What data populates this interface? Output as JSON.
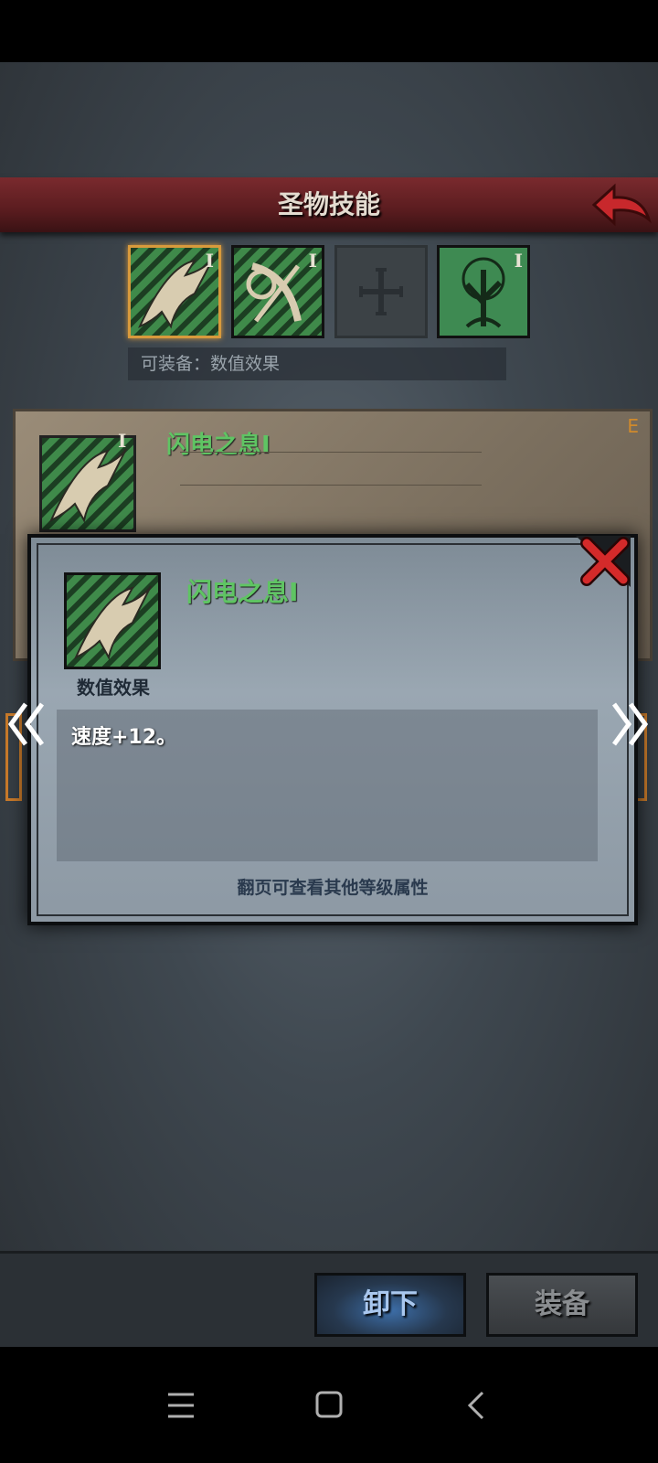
{
  "header": {
    "title": "圣物技能"
  },
  "skill_slots": [
    {
      "level": "I",
      "icon": "lightning-breath-icon",
      "selected": true
    },
    {
      "level": "I",
      "icon": "bow-sword-icon",
      "selected": false
    },
    {
      "level": "",
      "icon": "empty-cross-slot-icon",
      "selected": false
    },
    {
      "level": "I",
      "icon": "tree-icon",
      "selected": false
    }
  ],
  "equip_hint": "可装备：数值效果",
  "background_card": {
    "name": "闪电之息I",
    "level": "I",
    "grade": "E"
  },
  "dialog": {
    "name": "闪电之息I",
    "icon_label": "数值效果",
    "description": "速度+12。",
    "hint": "翻页可查看其他等级属性"
  },
  "actions": {
    "unequip": "卸下",
    "equip": "装备"
  },
  "colors": {
    "title_bar": "#6a2226",
    "skill_green": "#5fc463",
    "selected_border": "#d89a3c",
    "unequip_blue": "#3d6ea8"
  }
}
